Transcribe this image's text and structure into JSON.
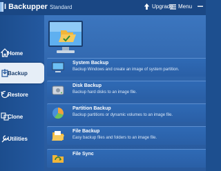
{
  "app": {
    "name": "I Backupper",
    "edition": "Standard"
  },
  "header": {
    "upgrade_label": "Upgrade",
    "menu_label": "Menu"
  },
  "sidebar": {
    "items": [
      {
        "label": "Home",
        "icon": "home-icon",
        "active": false
      },
      {
        "label": "Backup",
        "icon": "backup-icon",
        "active": true
      },
      {
        "label": "Restore",
        "icon": "restore-icon",
        "active": false
      },
      {
        "label": "Clone",
        "icon": "clone-icon",
        "active": false
      },
      {
        "label": "Utilities",
        "icon": "utilities-icon",
        "active": false
      }
    ]
  },
  "backup_options": [
    {
      "title": "System Backup",
      "desc": "Backup Windows and create an image of system partition.",
      "icon": "system-backup-icon"
    },
    {
      "title": "Disk Backup",
      "desc": "Backup hard disks to an image file.",
      "icon": "disk-backup-icon"
    },
    {
      "title": "Partition Backup",
      "desc": "Backup partitions or dynamic volumes to an image file.",
      "icon": "partition-backup-icon"
    },
    {
      "title": "File Backup",
      "desc": "Easy backup files and folders to an image file.",
      "icon": "file-backup-icon"
    },
    {
      "title": "File Sync",
      "desc": "",
      "icon": "file-sync-icon"
    }
  ],
  "colors": {
    "titlebar": "#1a4784",
    "sidebar": "#1d4f8d",
    "panel": "#2d62a8",
    "active_nav": "#e6eef7"
  }
}
